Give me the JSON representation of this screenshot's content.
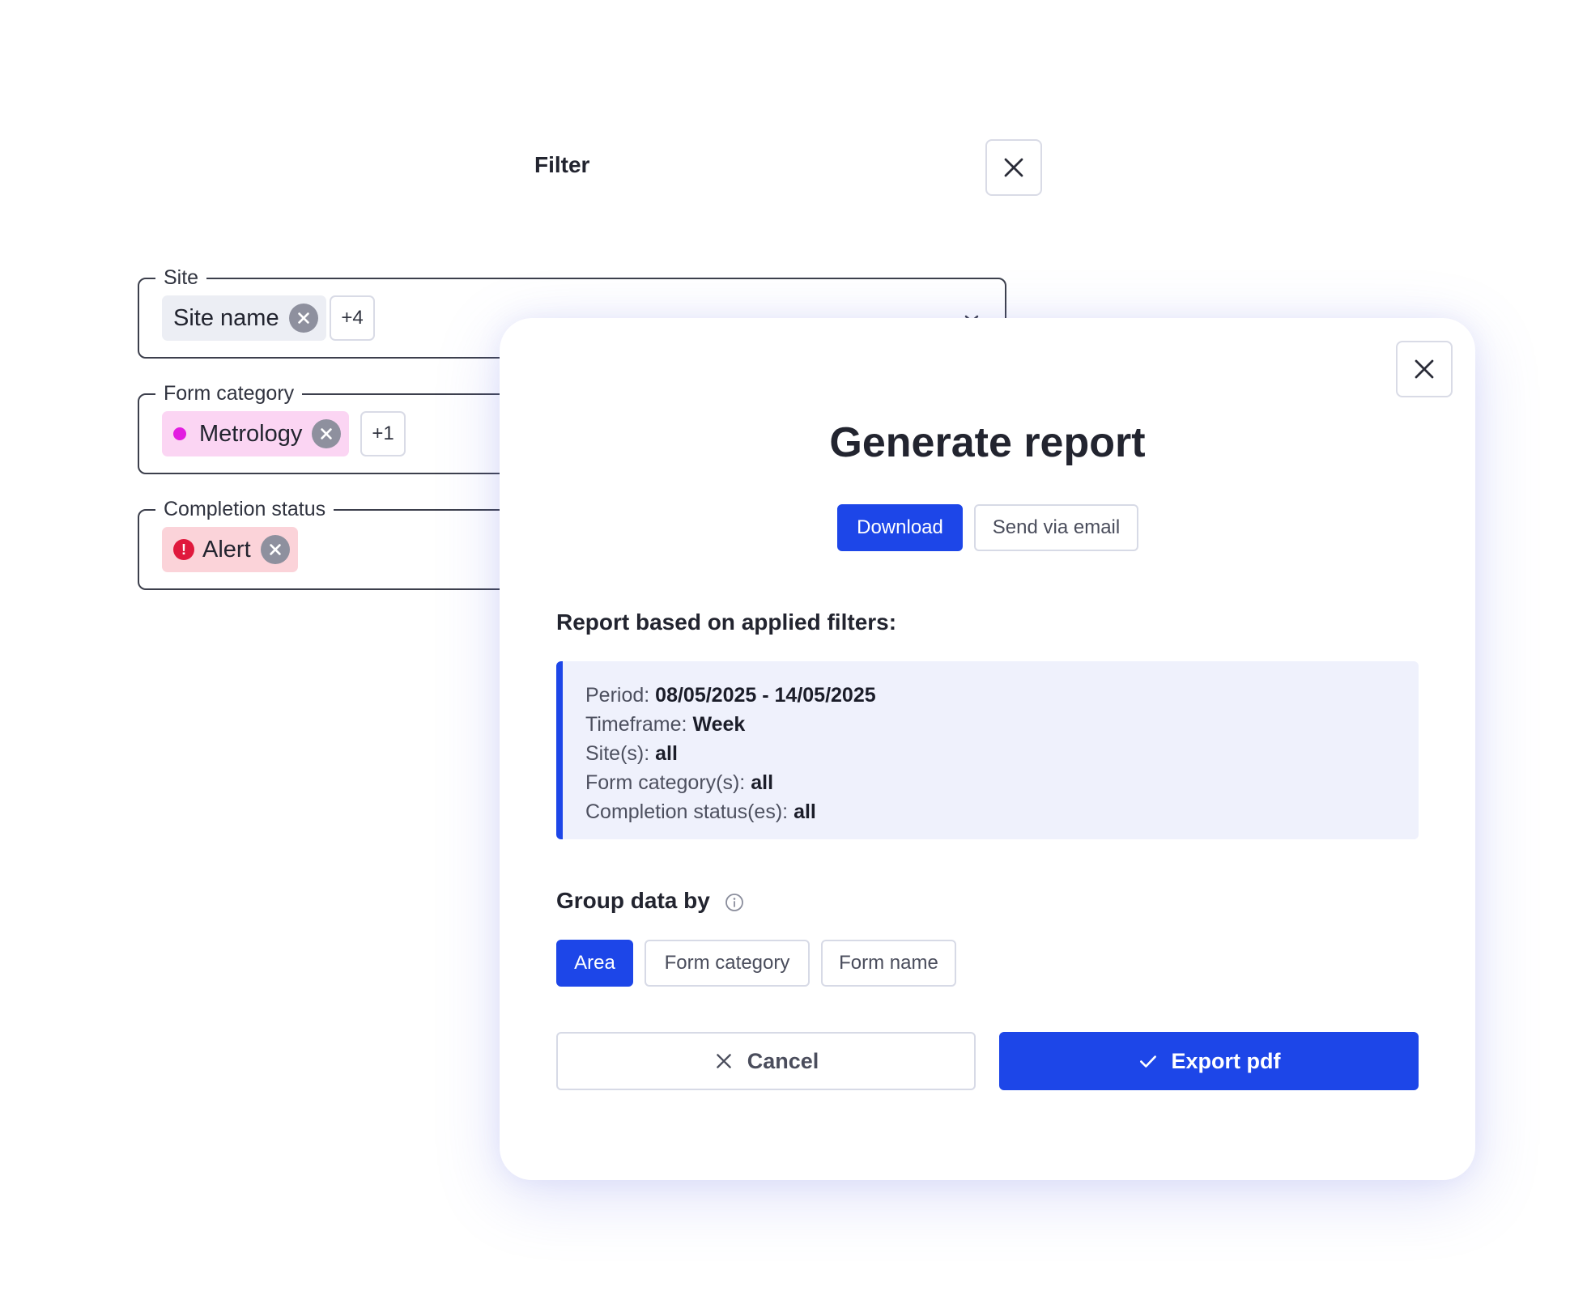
{
  "filter_panel": {
    "title": "Filter",
    "fields": {
      "site": {
        "legend": "Site",
        "chip_label": "Site name",
        "more_count": "+4"
      },
      "form_category": {
        "legend": "Form category",
        "chip_label": "Metrology",
        "more_count": "+1"
      },
      "completion_status": {
        "legend": "Completion status",
        "chip_label": "Alert",
        "alert_glyph": "!"
      }
    }
  },
  "report_modal": {
    "title": "Generate report",
    "delivery_tabs": {
      "download": "Download",
      "email": "Send via email",
      "selected": "Download"
    },
    "filters_heading": "Report based on applied filters:",
    "summary": {
      "period_label": "Period:",
      "period_value": "08/05/2025 - 14/05/2025",
      "timeframe_label": "Timeframe:",
      "timeframe_value": "Week",
      "sites_label": "Site(s):",
      "sites_value": "all",
      "form_category_label": "Form category(s):",
      "form_category_value": "all",
      "completion_label": "Completion status(es):",
      "completion_value": "all"
    },
    "group_by": {
      "heading": "Group data by",
      "options": {
        "area": "Area",
        "form_category": "Form category",
        "form_name": "Form name"
      },
      "selected": "Area"
    },
    "actions": {
      "cancel": "Cancel",
      "export": "Export pdf"
    }
  },
  "icons": {
    "close": "close-icon",
    "remove_chip": "remove-chip-icon",
    "info": "info-icon",
    "check": "check-icon",
    "caret": "chevron-down-icon"
  },
  "colors": {
    "primary": "#1d46e8",
    "metrology_dot": "#e21ce0",
    "alert": "#e0193d",
    "summary_bg": "#eff1fc"
  }
}
